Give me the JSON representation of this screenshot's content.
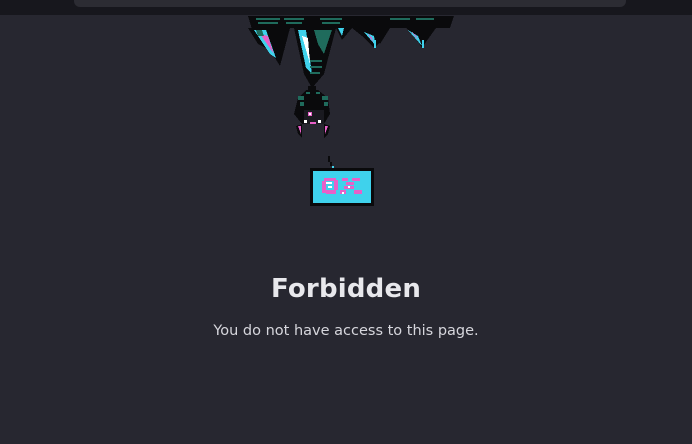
{
  "error": {
    "title": "Forbidden",
    "message": "You do not have access to this page."
  },
  "illustration": {
    "subject": "bat hanging from cave ceiling holding a sign",
    "sign_text": "?!",
    "colors": {
      "background": "#272730",
      "rock_dark": "#0a0a0c",
      "teal": "#1f6b5c",
      "cyan": "#3fd2ec",
      "pink": "#e860c8",
      "white": "#ffffff"
    }
  }
}
